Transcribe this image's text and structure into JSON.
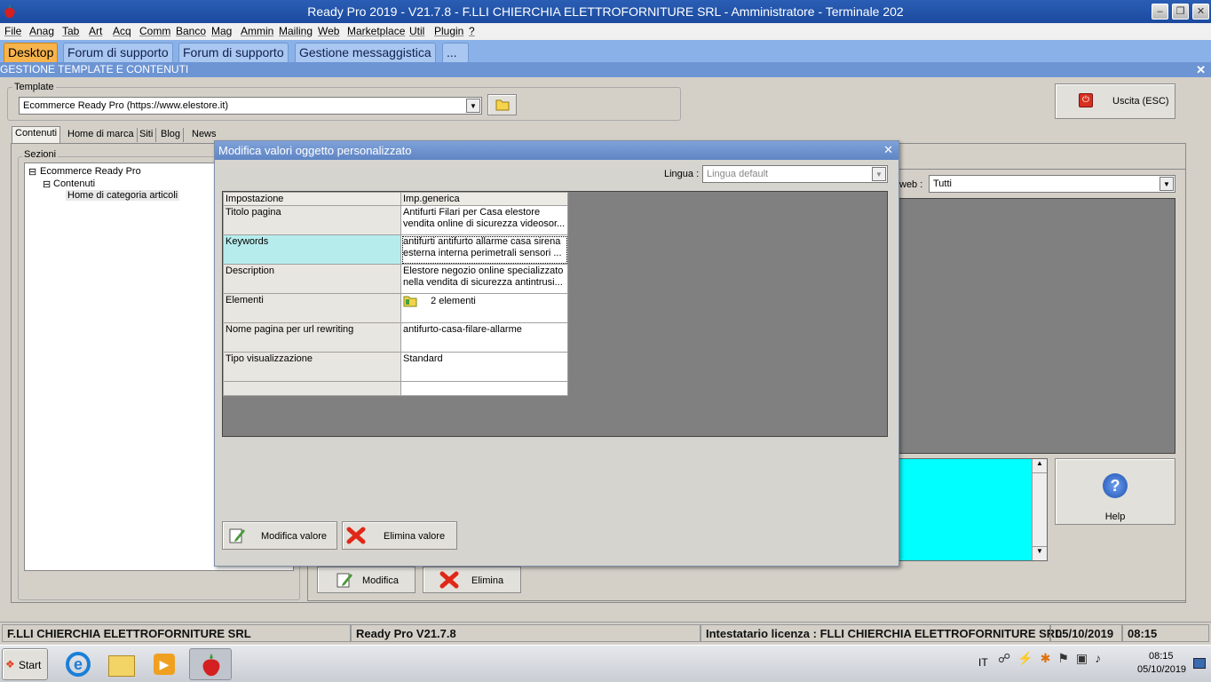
{
  "window": {
    "title": "Ready Pro 2019 - V21.7.8 - F.LLI CHIERCHIA ELETTROFORNITURE SRL - Amministratore - Terminale 202"
  },
  "menu": [
    "File",
    "Anag",
    "Tab",
    "Art",
    "Acq",
    "Comm",
    "Banco",
    "Mag",
    "Ammin",
    "Mailing",
    "Web",
    "Marketplace",
    "Util",
    "Plugin",
    "?"
  ],
  "tabs": [
    "Desktop",
    "Forum di supporto",
    "Forum di supporto",
    "Gestione messaggistica",
    "..."
  ],
  "subwindow": {
    "title": "GESTIONE TEMPLATE E CONTENUTI"
  },
  "template": {
    "label": "Template",
    "value": "Ecommerce Ready Pro (https://www.elestore.it)"
  },
  "exit_label": "Uscita (ESC)",
  "inner_tabs": [
    "Contenuti",
    "Home di marca",
    "Siti",
    "Blog",
    "News"
  ],
  "sections": {
    "label": "Sezioni",
    "tree": [
      "Ecommerce Ready Pro",
      "Contenuti",
      "Home di categoria articoli"
    ]
  },
  "right": {
    "filter_label": "web :",
    "filter_value": "Tutti",
    "help_label": "Help"
  },
  "bottom_buttons": {
    "modify": "Modifica",
    "delete": "Elimina"
  },
  "dialog": {
    "title": "Modifica valori oggetto personalizzato",
    "language_label": "Lingua :",
    "language_value": "Lingua default",
    "columns": [
      "Impostazione",
      "Imp.generica"
    ],
    "rows": [
      {
        "key": "Titolo pagina",
        "line1": "Antifurti Filari per Casa elestore",
        "line2": "vendita online di sicurezza videosor..."
      },
      {
        "key": "Keywords",
        "line1": "antifurti antifurto allarme casa sirena",
        "line2": "esterna interna perimetrali sensori ..."
      },
      {
        "key": "Description",
        "line1": "Elestore negozio online specializzato",
        "line2": "nella vendita di sicurezza antintrusi..."
      },
      {
        "key": "Elementi",
        "line1": "2 elementi",
        "line2": ""
      },
      {
        "key": "Nome pagina per url rewriting",
        "line1": "antifurto-casa-filare-allarme",
        "line2": ""
      },
      {
        "key": "Tipo visualizzazione",
        "line1": "Standard",
        "line2": ""
      }
    ],
    "modify_button": "Modifica valore",
    "delete_button": "Elimina valore"
  },
  "status": {
    "company": "F.LLI CHIERCHIA ELETTROFORNITURE SRL",
    "version": "Ready Pro V21.7.8",
    "license": "Intestatario licenza : FLLI CHIERCHIA ELETTROFORNITURE SRL",
    "date": "05/10/2019",
    "time": "08:15"
  },
  "taskbar": {
    "start": "Start",
    "lang": "IT",
    "clock_time": "08:15",
    "clock_date": "05/10/2019"
  },
  "colors": {
    "titlebar": "#1b4aa0",
    "active_tab": "#f8b44c",
    "highlight_row": "#b7ecec",
    "cyan_area": "#00ffff"
  }
}
